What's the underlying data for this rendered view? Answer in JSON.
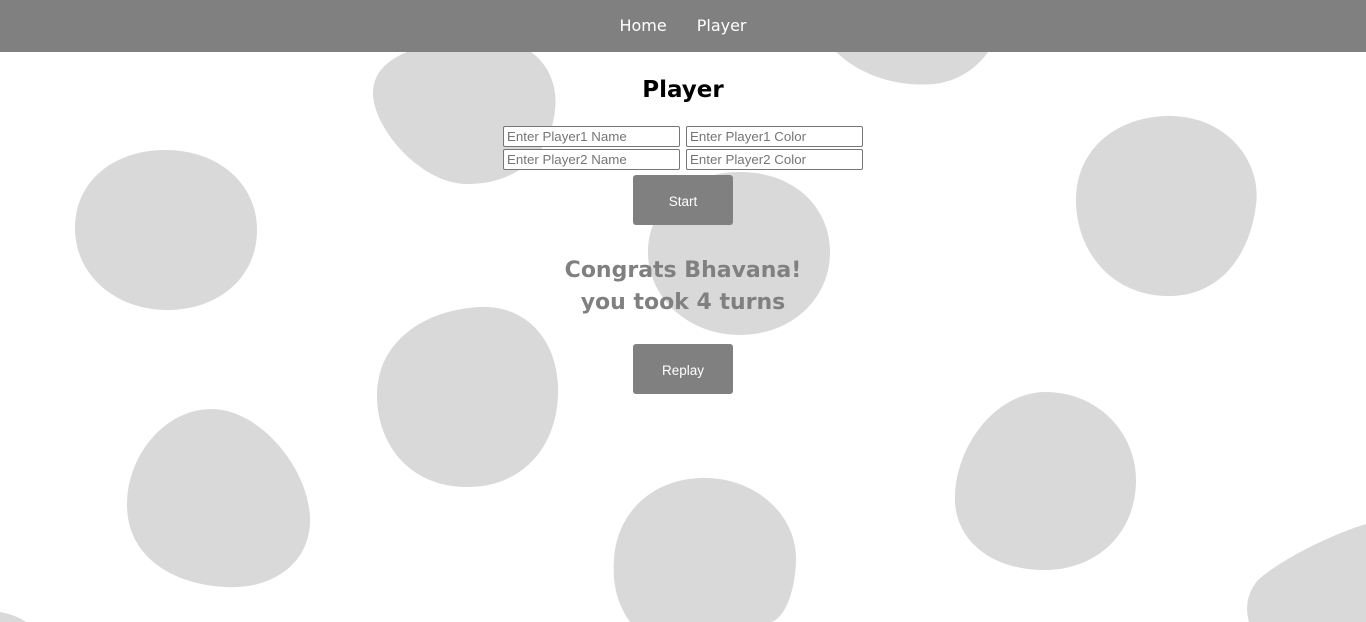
{
  "nav": {
    "items": [
      {
        "label": "Home"
      },
      {
        "label": "Player"
      }
    ]
  },
  "main": {
    "title": "Player",
    "player1_name_placeholder": "Enter Player1 Name",
    "player1_color_placeholder": "Enter Player1 Color",
    "player2_name_placeholder": "Enter Player2 Name",
    "player2_color_placeholder": "Enter Player2 Color",
    "start_label": "Start",
    "congrats_line": "Congrats Bhavana!",
    "turns_line": "you took 4 turns",
    "replay_label": "Replay"
  },
  "colors": {
    "navbar": "#808080",
    "blob": "#d9d9d9",
    "button": "#808080",
    "result_text": "#808080"
  }
}
